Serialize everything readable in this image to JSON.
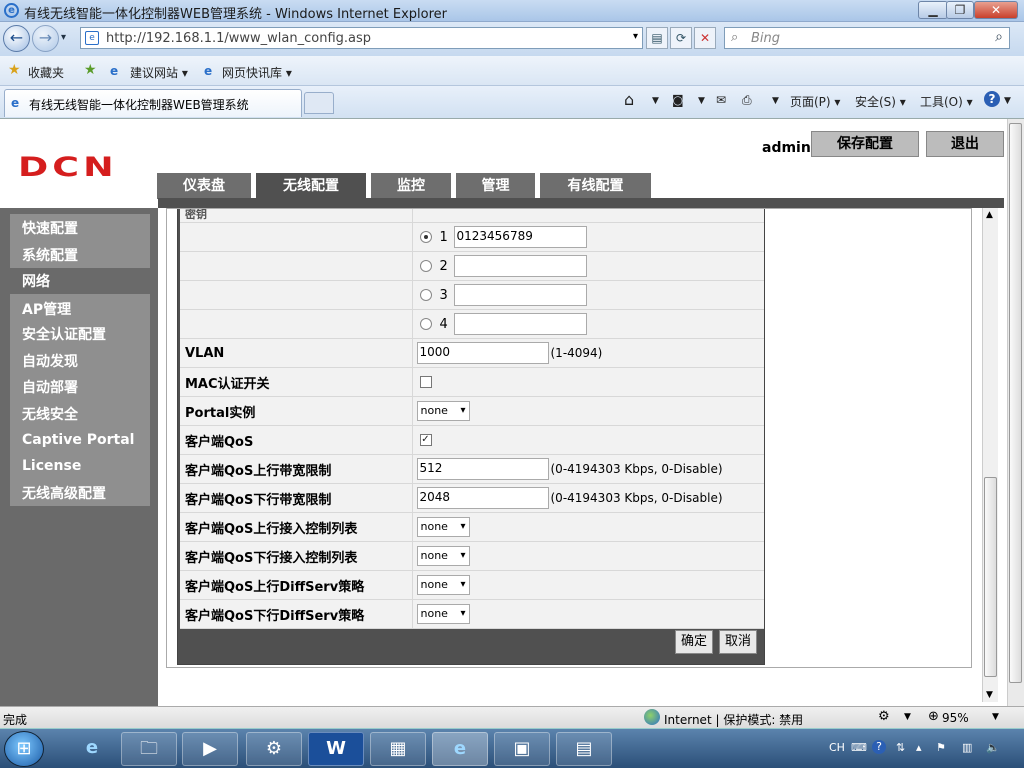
{
  "browser": {
    "window_title": "有线无线智能一体化控制器WEB管理系统 - Windows Internet Explorer",
    "url": "http://192.168.1.1/www_wlan_config.asp",
    "search_placeholder": "Bing",
    "tab_title": "有线无线智能一体化控制器WEB管理系统",
    "favorites_label": "收藏夹",
    "fav_items": [
      "建议网站 ▾",
      "网页快讯库 ▾"
    ],
    "commands": [
      "页面(P) ▾",
      "安全(S) ▾",
      "工具(O) ▾"
    ],
    "status_left": "完成",
    "status_zone": "Internet | 保护模式: 禁用",
    "zoom": "95%"
  },
  "header": {
    "logo_text": "DCN",
    "username": "admin",
    "save_label": "保存配置",
    "logout_label": "退出",
    "tabs": [
      "仪表盘",
      "无线配置",
      "监控",
      "管理",
      "有线配置"
    ]
  },
  "sidebar": {
    "items": [
      "快速配置",
      "系统配置",
      "网络",
      "AP管理",
      "安全认证配置",
      "自动发现",
      "自动部署",
      "无线安全",
      "Captive Portal",
      "License",
      "无线高级配置"
    ]
  },
  "form": {
    "partial_row": "密钥",
    "key_rows": [
      {
        "num": "1",
        "value": "0123456789",
        "selected": true
      },
      {
        "num": "2",
        "value": "",
        "selected": false
      },
      {
        "num": "3",
        "value": "",
        "selected": false
      },
      {
        "num": "4",
        "value": "",
        "selected": false
      }
    ],
    "vlan_label": "VLAN",
    "vlan_value": "1000",
    "vlan_hint": "(1-4094)",
    "mac_label": "MAC认证开关",
    "mac_checked": false,
    "portal_label": "Portal实例",
    "portal_value": "none",
    "qos_label": "客户端QoS",
    "qos_checked": true,
    "qos_up_label": "客户端QoS上行带宽限制",
    "qos_up_value": "512",
    "qos_up_hint": "(0-4194303 Kbps, 0-Disable)",
    "qos_down_label": "客户端QoS下行带宽限制",
    "qos_down_value": "2048",
    "qos_down_hint": "(0-4194303 Kbps, 0-Disable)",
    "acl_up_label": "客户端QoS上行接入控制列表",
    "acl_up_value": "none",
    "acl_down_label": "客户端QoS下行接入控制列表",
    "acl_down_value": "none",
    "diff_up_label": "客户端QoS上行DiffServ策略",
    "diff_up_value": "none",
    "diff_down_label": "客户端QoS下行DiffServ策略",
    "diff_down_value": "none",
    "ok_label": "确定",
    "cancel_label": "取消"
  },
  "taskbar": {
    "lang": "CH",
    "apps": [
      "ie-icon",
      "explorer-icon",
      "media-icon",
      "tool-icon",
      "wps-icon",
      "network-icon",
      "ie-window-icon",
      "picture-icon",
      "calc-icon"
    ]
  }
}
